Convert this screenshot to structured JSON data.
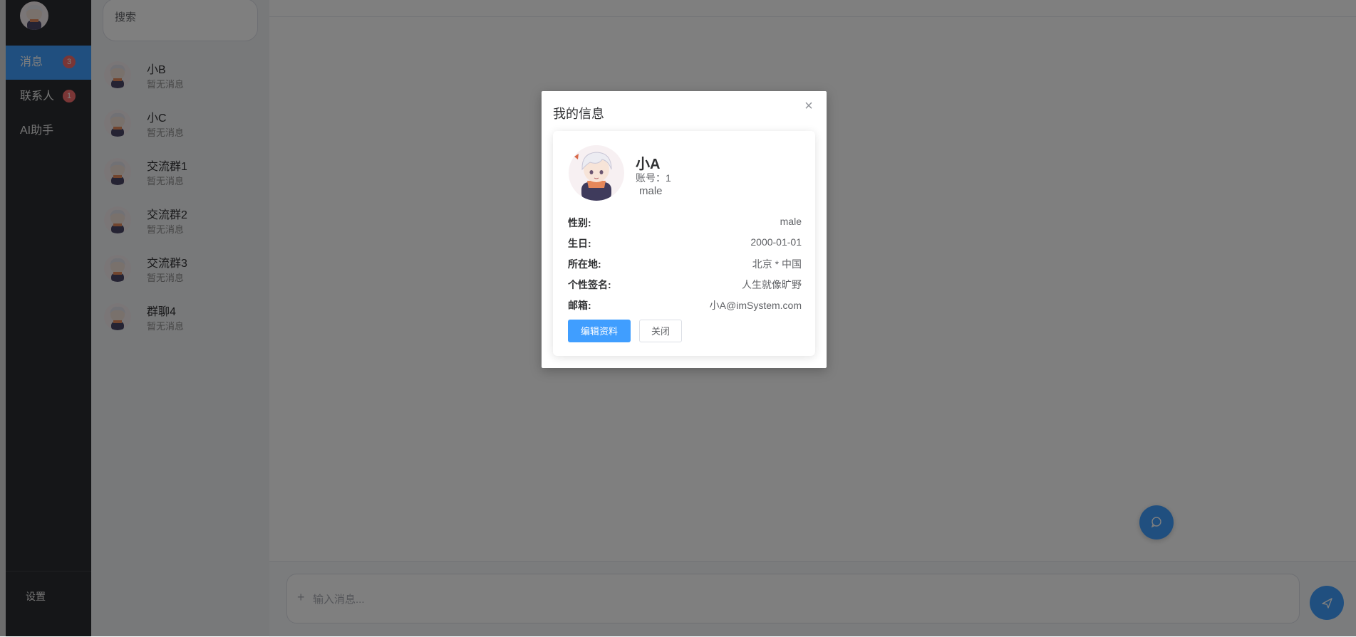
{
  "nav": {
    "items": [
      {
        "label": "消息",
        "badge": "3"
      },
      {
        "label": "联系人",
        "badge": "1"
      },
      {
        "label": "AI助手",
        "badge": ""
      }
    ],
    "settings": "设置"
  },
  "sidebar": {
    "search_placeholder": "搜索",
    "conversations": [
      {
        "name": "小B",
        "preview": "暂无消息"
      },
      {
        "name": "小C",
        "preview": "暂无消息"
      },
      {
        "name": "交流群1",
        "preview": "暂无消息"
      },
      {
        "name": "交流群2",
        "preview": "暂无消息"
      },
      {
        "name": "交流群3",
        "preview": "暂无消息"
      },
      {
        "name": "群聊4",
        "preview": "暂无消息"
      }
    ]
  },
  "chat": {
    "input_placeholder": "输入消息..."
  },
  "dialog": {
    "title": "我的信息",
    "close_symbol": "×",
    "profile": {
      "name": "小A",
      "account": "账号：1",
      "gender_tag": "male"
    },
    "fields": [
      {
        "key": "性别:",
        "value": "male"
      },
      {
        "key": "生日:",
        "value": "2000-01-01"
      },
      {
        "key": "所在地:",
        "value": "北京 * 中国"
      },
      {
        "key": "个性签名:",
        "value": "人生就像旷野"
      },
      {
        "key": "邮箱:",
        "value": "小A@imSystem.com"
      }
    ],
    "edit_button": "编辑资料",
    "close_button": "关闭"
  },
  "colors": {
    "accent": "#409eff",
    "nav_bg": "#2b2d30",
    "badge": "#f56c6c"
  }
}
